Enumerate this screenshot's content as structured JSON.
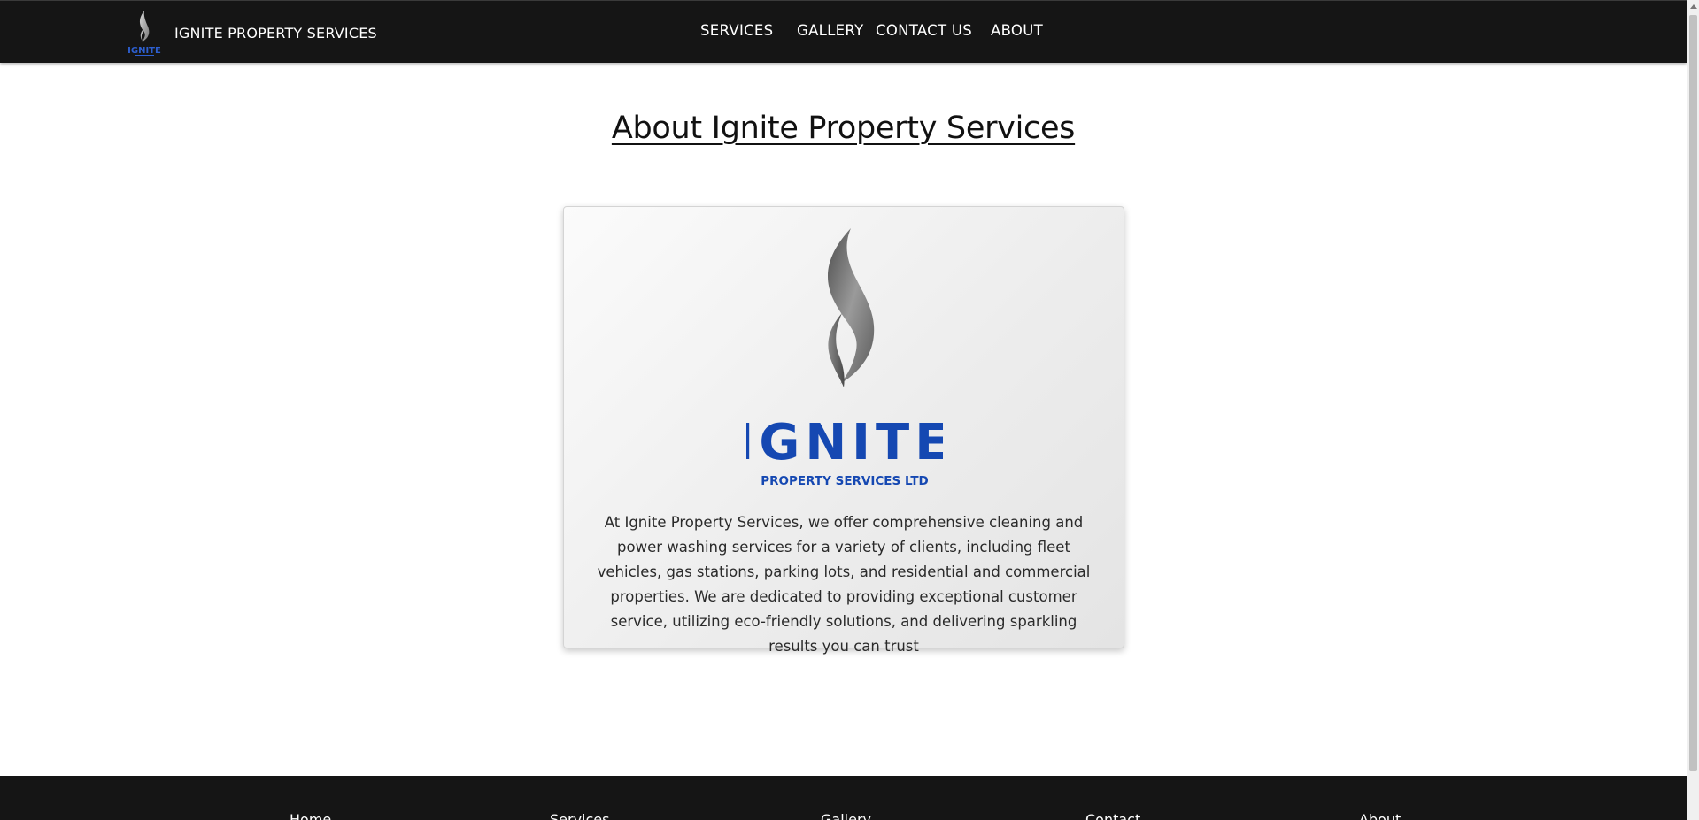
{
  "header": {
    "brand_name": "IGNITE PROPERTY SERVICES",
    "logo_word": "IGNITE",
    "nav": {
      "services": "SERVICES",
      "gallery": "GALLERY",
      "contact": "CONTACT US",
      "about": "ABOUT"
    }
  },
  "main": {
    "title": "About Ignite Property Services",
    "card": {
      "logo_word": "IGNITE",
      "logo_subtitle": "PROPERTY SERVICES LTD",
      "description": "At Ignite Property Services, we offer comprehensive cleaning and power washing services for a variety of clients, including fleet vehicles, gas stations, parking lots, and residential and commercial properties. We are dedicated to providing exceptional customer service, utilizing eco-friendly solutions, and delivering sparkling results you can trust"
    }
  },
  "footer": {
    "links": {
      "home": "Home",
      "services": "Services",
      "gallery": "Gallery",
      "contact": "Contact",
      "about": "About"
    }
  },
  "colors": {
    "header_bg": "#151515",
    "logo_blue": "#1548b2",
    "flame_gray": "#6e6e6e"
  },
  "icons": {
    "brand_logo": "flame-logo-icon",
    "card_logo": "flame-logo-icon"
  }
}
